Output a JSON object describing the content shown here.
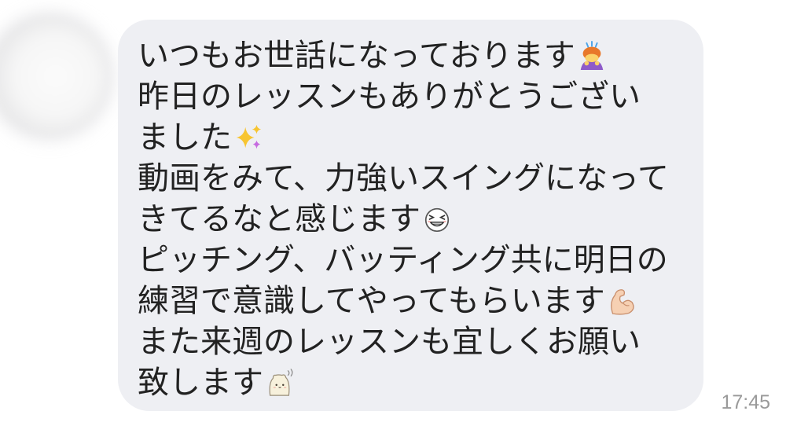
{
  "chat": {
    "timestamp": "17:45",
    "message": {
      "lines": [
        {
          "text": "いつもお世話になっております",
          "icon": "woman-bowing-icon"
        },
        {
          "text": "昨日のレッスンもありがとうござい"
        },
        {
          "text": "ました",
          "icon": "sparkles-icon"
        },
        {
          "text": "動画をみて、力強いスイングになって"
        },
        {
          "text": "きてるなと感じます",
          "icon": "grinning-squint-face-icon"
        },
        {
          "text": "ピッチング、バッティング共に明日の"
        },
        {
          "text": "練習で意識してやってもらいます",
          "icon": "flexed-biceps-icon"
        },
        {
          "text": "また来週のレッスンも宜しくお願い"
        },
        {
          "text": "致します",
          "icon": "cream-blob-character-icon"
        }
      ]
    }
  },
  "colors": {
    "background": "#ffffff",
    "bubble": "#eeeff3",
    "text": "#222222",
    "timestamp": "#9a9a9a"
  }
}
